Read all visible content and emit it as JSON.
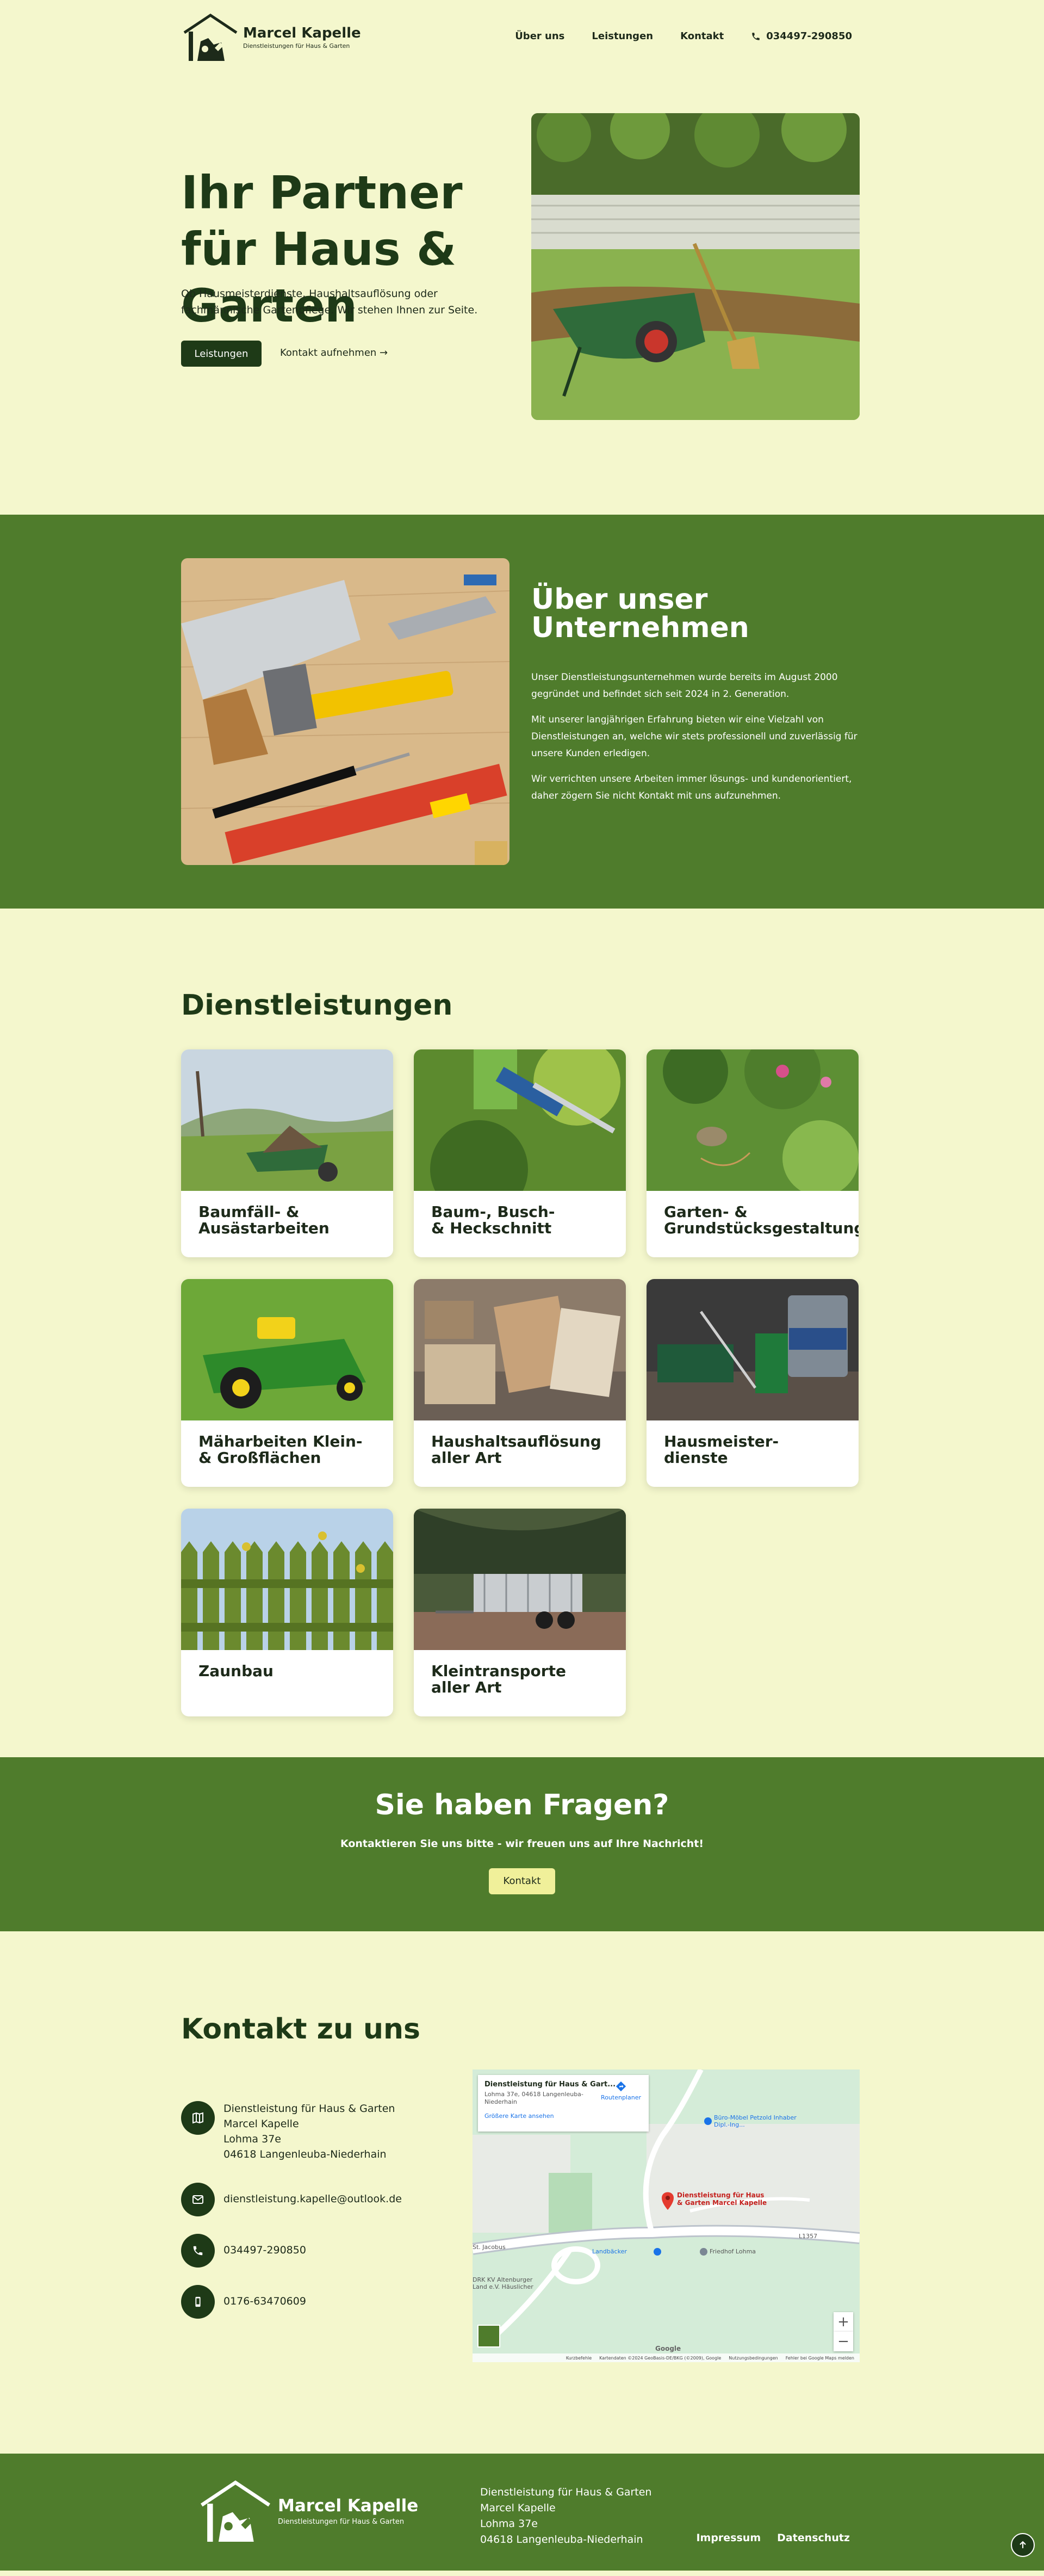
{
  "brand": {
    "name": "Marcel Kapelle",
    "tagline": "Dienstleistungen für Haus & Garten"
  },
  "nav": {
    "items": [
      "Über uns",
      "Leistungen",
      "Kontakt"
    ],
    "phone": "034497-290850"
  },
  "hero": {
    "title": "Ihr Partner für Haus & Garten",
    "text": "Ob Hausmeisterdienste, Haushaltsauflösung oder fachmännische Gartenpflege. Wir stehen Ihnen zur Seite.",
    "primary_button": "Leistungen",
    "secondary_link": "Kontakt aufnehmen →"
  },
  "about": {
    "title": "Über unser Unternehmen",
    "paragraphs": [
      "Unser Dienstleistungsunternehmen wurde bereits im August 2000 gegründet und befindet sich seit 2024 in 2. Generation.",
      "Mit unserer langjährigen Erfahrung bieten wir eine Vielzahl von Dienstleistungen an, welche wir stets professionell und zuverlässig für unsere Kunden erledigen.",
      "Wir verrichten unsere Arbeiten immer lösungs- und kundenorientiert, daher zögern Sie nicht Kontakt mit uns aufzunehmen."
    ]
  },
  "services": {
    "title": "Dienstleistungen",
    "items": [
      {
        "line1": "Baumfäll- &",
        "line2": "Ausästarbeiten"
      },
      {
        "line1": "Baum-, Busch-",
        "line2": "& Heckschnitt"
      },
      {
        "line1": "Garten- &",
        "line2": "Grundstücksgestaltung"
      },
      {
        "line1": "Mäharbeiten Klein-",
        "line2": "& Großflächen"
      },
      {
        "line1": "Haushaltsauflösung",
        "line2": "aller Art"
      },
      {
        "line1": "Hausmeister-",
        "line2": "dienste"
      },
      {
        "line1": "Zaunbau",
        "line2": ""
      },
      {
        "line1": "Kleintransporte",
        "line2": "aller Art"
      }
    ]
  },
  "cta": {
    "title": "Sie haben Fragen?",
    "subtitle": "Kontaktieren Sie uns bitte - wir freuen uns auf Ihre Nachricht!",
    "button": "Kontakt"
  },
  "contact": {
    "title": "Kontakt zu uns",
    "address": [
      "Dienstleistung für Haus & Garten",
      "Marcel Kapelle",
      "Lohma 37e",
      "04618 Langenleuba-Niederhain"
    ],
    "email": "dienstleistung.kapelle@outlook.de",
    "phone": "034497-290850",
    "mobile": "0176-63470609"
  },
  "map": {
    "card_title": "Dienstleistung für Haus & Gart...",
    "card_address": "Lohma 37e, 04618 Langenleuba-Niederhain",
    "card_link": "Größere Karte ansehen",
    "route_label": "Routenplaner",
    "marker_label": "Dienstleistung für Haus & Garten Marcel Kapelle",
    "labels": [
      "Büro-Möbel Petzold Inhaber Dipl.-Ing...",
      "Landbäcker",
      "Friedhof Lohma",
      "St. Jacobus",
      "DRK KV Altenburger Land e.V. Häuslicher",
      "L1357"
    ],
    "footer": [
      "Kurzbefehle",
      "Kartendaten ©2024 GeoBasis-DE/BKG (©2009), Google",
      "Nutzungsbedingungen",
      "Fehler bei Google Maps melden"
    ],
    "zoom_in": "+",
    "zoom_out": "−",
    "google": "Google"
  },
  "footer": {
    "address": [
      "Dienstleistung für Haus & Garten",
      "Marcel Kapelle",
      "Lohma 37e",
      "04618 Langenleuba-Niederhain"
    ],
    "links": [
      "Impressum",
      "Datenschutz"
    ]
  },
  "colors": {
    "background": "#f4f7cd",
    "green": "#4f7c2c",
    "dark_green": "#1e3a17",
    "yellow_button": "#f0f09a"
  }
}
